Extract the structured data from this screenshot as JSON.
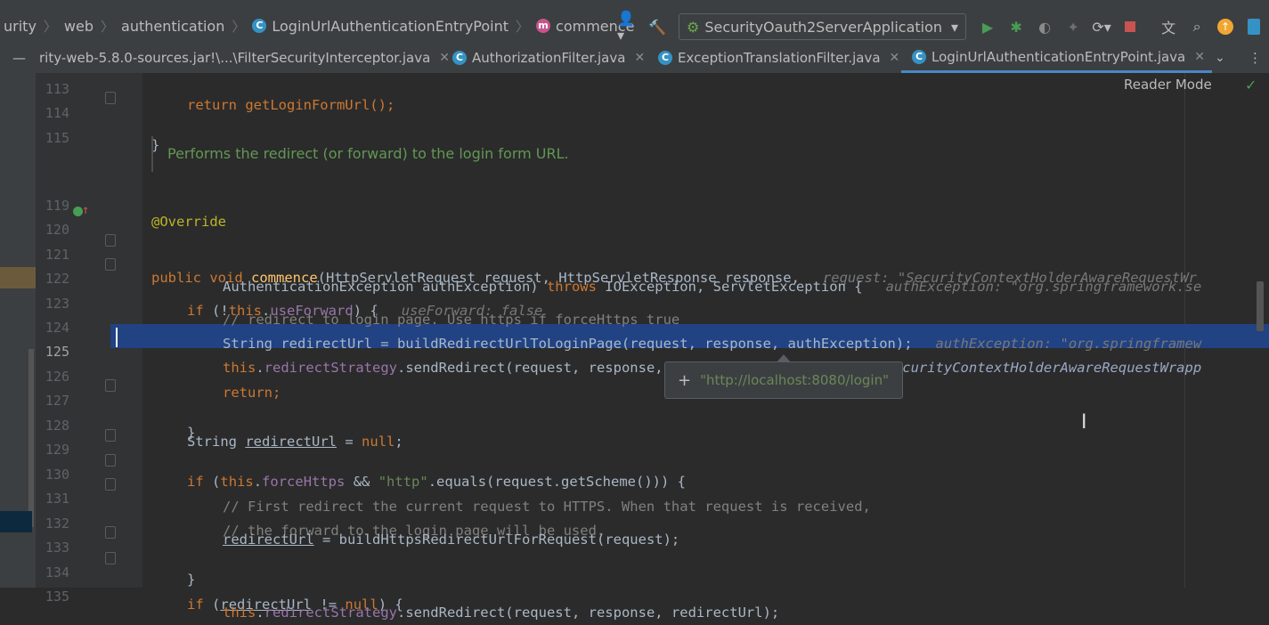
{
  "breadcrumb": [
    "urity",
    "web",
    "authentication",
    "LoginUrlAuthenticationEntryPoint",
    "commence"
  ],
  "run_config": "SecurityOauth2ServerApplication",
  "tabs": [
    {
      "label": "rity-web-5.8.0-sources.jar!\\...\\FilterSecurityInterceptor.java"
    },
    {
      "label": "AuthorizationFilter.java"
    },
    {
      "label": "ExceptionTranslationFilter.java"
    },
    {
      "label": "LoginUrlAuthenticationEntryPoint.java",
      "active": true
    }
  ],
  "reader_mode": "Reader Mode",
  "doc_comment": "Performs the redirect (or forward) to the login form URL.",
  "popup_value": "\"http://localhost:8080/login\"",
  "line_numbers": [
    "113",
    "114",
    "115",
    "119",
    "120",
    "121",
    "122",
    "123",
    "124",
    "125",
    "126",
    "127",
    "128",
    "129",
    "130",
    "131",
    "132",
    "133",
    "134",
    "135"
  ],
  "code": {
    "l113": "return getLoginFormUrl();",
    "l114": "}",
    "l119": "@Override",
    "l120_a": "public",
    "l120_b": "void",
    "l120_c": "commence",
    "l120_d": "(HttpServletRequest request, HttpServletResponse response,",
    "l120_hint": "request: \"SecurityContextHolderAwareRequestWr",
    "l121_a": "AuthenticationException authException)",
    "l121_b": "throws",
    "l121_c": "IOException, ServletException {",
    "l121_hint": "authException: \"org.springframework.se",
    "l122_a": "if",
    "l122_b": "(!",
    "l122_c": "this",
    "l122_d": ".",
    "l122_e": "useForward",
    "l122_f": ") {",
    "l122_hint": "useForward: false",
    "l123": "// redirect to login page. Use https if forceHttps true",
    "l124": "String redirectUrl = buildRedirectUrlToLoginPage(request, response, authException);",
    "l124_hint": "authException: \"org.springframew",
    "l125_a": "this",
    "l125_b": ".",
    "l125_c": "redirectStrategy",
    "l125_d": ".sendRedirect(request, response, redirectUrl);",
    "l125_hint": "request: \"SecurityContextHolderAwareRequestWrapp",
    "l126": "return;",
    "l127": "}",
    "l128_a": "String",
    "l128_b": "redirectUrl",
    "l128_c": "=",
    "l128_d": "null",
    "l128_e": ";",
    "l129_a": "if",
    "l129_b": "(",
    "l129_c": "this",
    "l129_d": ".",
    "l129_e": "forceHttps",
    "l129_f": "&&",
    "l129_g": "\"http\"",
    "l129_h": ".equals(request.getScheme())) {",
    "l130": "// First redirect the current request to HTTPS. When that request is received,",
    "l131": "// the forward to the login page will be used.",
    "l132_a": "redirectUrl",
    "l132_b": "= buildHttpsRedirectUrlForRequest(request);",
    "l133": "}",
    "l134_a": "if",
    "l134_b": "(",
    "l134_c": "redirectUrl",
    "l134_d": "!=",
    "l134_e": "null",
    "l134_f": ") {",
    "l135_a": "this",
    "l135_b": ".",
    "l135_c": "redirectStrategy",
    "l135_d": ".sendRedirect(request, response, redirectUrl);"
  },
  "colors": {
    "accent": "#4a88c7",
    "selection": "#214283",
    "keyword": "#cc7832",
    "string": "#6a8759"
  }
}
